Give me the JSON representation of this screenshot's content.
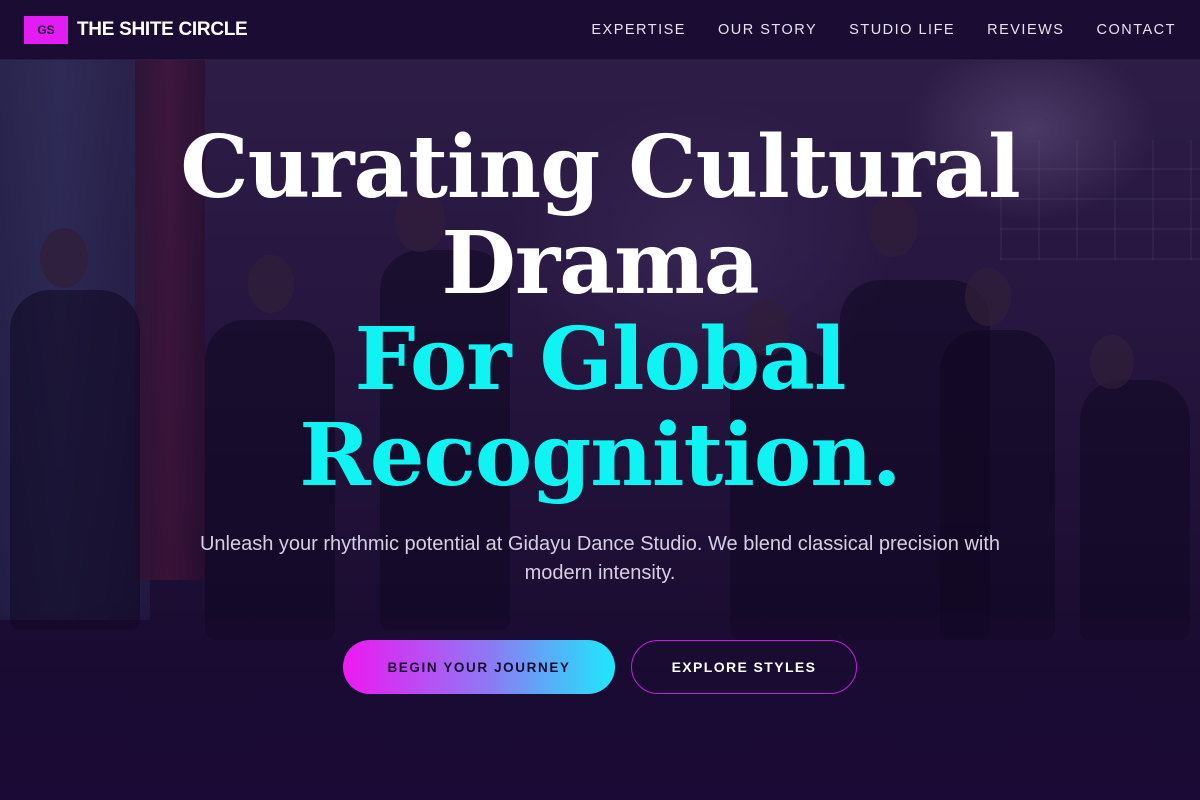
{
  "brand": {
    "logo_text": "GS",
    "name": "THE SHITE CIRCLE"
  },
  "nav": {
    "items": [
      {
        "label": "EXPERTISE"
      },
      {
        "label": "OUR STORY"
      },
      {
        "label": "STUDIO LIFE"
      },
      {
        "label": "REVIEWS"
      },
      {
        "label": "CONTACT"
      }
    ]
  },
  "hero": {
    "headline_line1": "Curating Cultural",
    "headline_line2": "Drama",
    "headline_line3": "For Global",
    "headline_line4": "Recognition.",
    "subtext": "Unleash your rhythmic potential at Gidayu Dance Studio. We blend classical precision with modern intensity.",
    "primary_cta": "BEGIN YOUR JOURNEY",
    "secondary_cta": "EXPLORE STYLES"
  },
  "colors": {
    "navbar_bg": "#1b0c33",
    "accent_magenta": "#e21cf2",
    "accent_cyan": "#10f3f3",
    "page_bg": "#16082e"
  }
}
